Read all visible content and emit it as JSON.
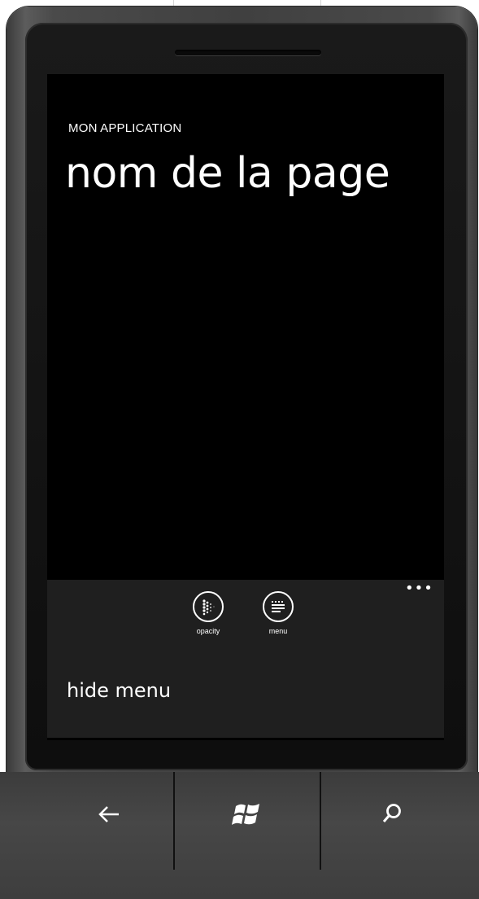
{
  "screen": {
    "app_title": "MON APPLICATION",
    "page_title": "nom de la page"
  },
  "app_bar": {
    "ellipsis": "•••",
    "buttons": [
      {
        "label": "opacity",
        "icon": "opacity-icon"
      },
      {
        "label": "menu",
        "icon": "menu-lines-icon"
      }
    ],
    "menu_items": [
      {
        "label": "hide menu"
      }
    ]
  },
  "hardware_buttons": [
    {
      "icon": "back-arrow-icon"
    },
    {
      "icon": "windows-start-icon"
    },
    {
      "icon": "search-icon"
    }
  ],
  "colors": {
    "screen_background": "#000000",
    "app_bar_background": "#1f1f1f",
    "foreground": "#ffffff",
    "phone_body": "#404040"
  }
}
